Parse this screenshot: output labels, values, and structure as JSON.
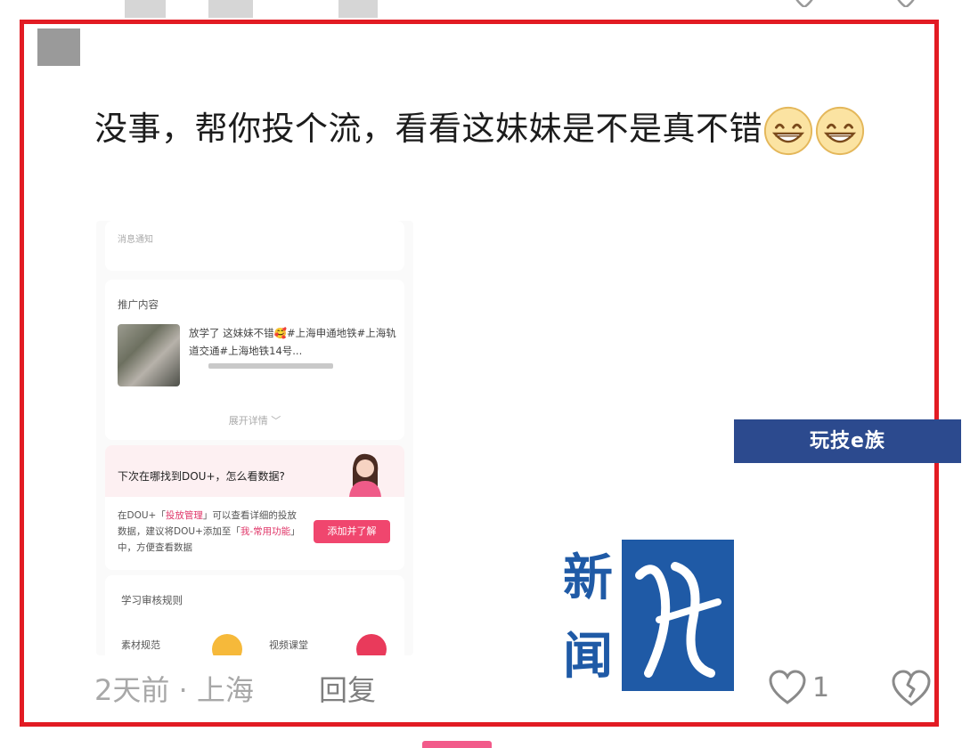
{
  "comment": {
    "text": "没事，帮你投个流，看看这妹妹是不是真不错",
    "emoji": "grinning-face-icon",
    "time": "2天前",
    "separator": "·",
    "location": "上海",
    "reply_label": "回复",
    "like_count": "1"
  },
  "screenshot": {
    "notice": "消息通知",
    "promo_header": "推广内容",
    "promo_text": "放学了 这妹妹不错🥰#上海申通地铁#上海轨道交通#上海地铁14号...",
    "expand": "展开详情 ﹀",
    "dou_question": "下次在哪找到DOU+，怎么看数据?",
    "dou_body_1": "在DOU+「",
    "dou_body_link1": "投放管理",
    "dou_body_2": "」可以查看详细的投放数据，建议将DOU+添加至「",
    "dou_body_link2": "我-常用功能",
    "dou_body_3": "」中，方便查看数据",
    "dou_button": "添加并了解",
    "learn_header": "学习审核规则",
    "material_rules": "素材规范",
    "video_class": "视频课堂"
  },
  "watermark": {
    "bar_text": "玩技e族",
    "logo_text": "新闻坊"
  },
  "colors": {
    "frame": "#e21b23",
    "accent_pink": "#f0466e",
    "watermark_blue": "#2c4a8e"
  }
}
